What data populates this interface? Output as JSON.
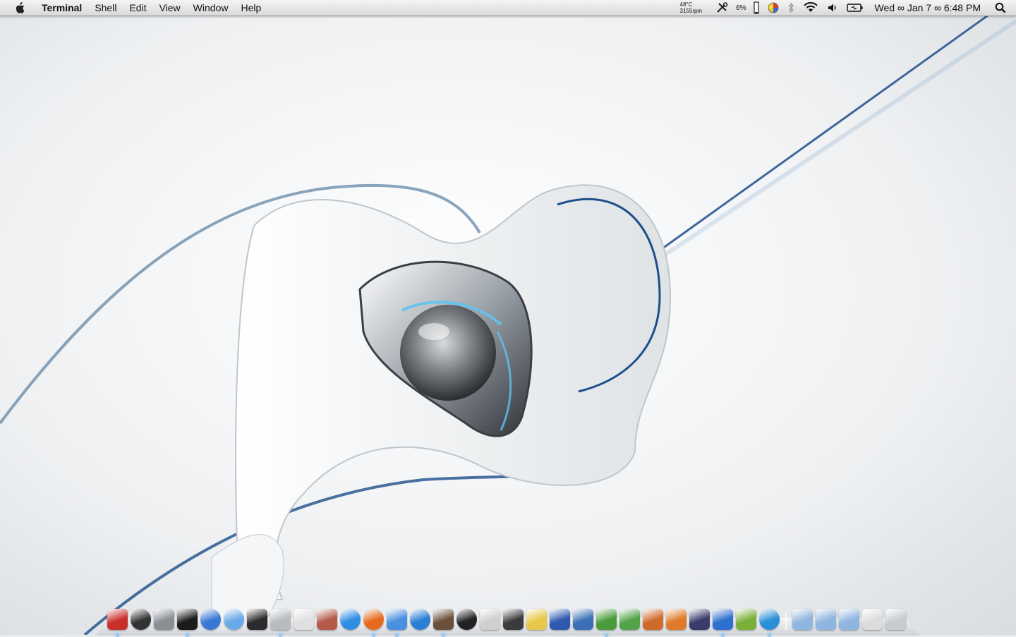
{
  "menubar": {
    "apple_icon": "apple-icon",
    "app_name": "Terminal",
    "menus": [
      "Shell",
      "Edit",
      "View",
      "Window",
      "Help"
    ],
    "status": {
      "temp": "48°C",
      "fan": "3155rpm",
      "cpu": "6%",
      "clock": "Wed ∞ Jan 7 ∞ 6:48 PM"
    }
  },
  "dock": {
    "icons": [
      {
        "name": "finder-icon",
        "color": "#c9302c"
      },
      {
        "name": "dashboard-icon",
        "color": "#333333"
      },
      {
        "name": "system-preferences-icon",
        "color": "#8a8f94"
      },
      {
        "name": "terminal-icon",
        "color": "#1b1b1b"
      },
      {
        "name": "sync-icon",
        "color": "#3a78d6"
      },
      {
        "name": "wifi-app-icon",
        "color": "#6aa9e8"
      },
      {
        "name": "activity-monitor-icon",
        "color": "#2b2b2b"
      },
      {
        "name": "disk-utility-icon",
        "color": "#b8bcc0"
      },
      {
        "name": "printer-icon",
        "color": "#e0e0e0"
      },
      {
        "name": "photo-booth-icon",
        "color": "#b35a4a"
      },
      {
        "name": "safari-icon",
        "color": "#2f8de4"
      },
      {
        "name": "firefox-icon",
        "color": "#e66a1e"
      },
      {
        "name": "itunes-icon",
        "color": "#4b8fe0"
      },
      {
        "name": "quicktime-icon",
        "color": "#2a7fd4"
      },
      {
        "name": "iphoto-icon",
        "color": "#6a4f3a"
      },
      {
        "name": "camera-icon",
        "color": "#222222"
      },
      {
        "name": "automator-icon",
        "color": "#cfcfcf"
      },
      {
        "name": "address-book-icon",
        "color": "#3b3b3b"
      },
      {
        "name": "notes-icon",
        "color": "#e8c84a"
      },
      {
        "name": "vmware-icon",
        "color": "#2f58b0"
      },
      {
        "name": "spaces-icon",
        "color": "#3b6fb5"
      },
      {
        "name": "charts-icon",
        "color": "#4a9b3a"
      },
      {
        "name": "cactus-icon",
        "color": "#53a34a"
      },
      {
        "name": "keynote-icon",
        "color": "#d06a2a"
      },
      {
        "name": "pages-icon",
        "color": "#e07a2a"
      },
      {
        "name": "pen-tool-icon",
        "color": "#3b3b6b"
      },
      {
        "name": "word-icon",
        "color": "#2f6fd0"
      },
      {
        "name": "adium-icon",
        "color": "#7ab03a"
      },
      {
        "name": "network-icon",
        "color": "#2a8fd8"
      },
      {
        "name": "separator",
        "color": ""
      },
      {
        "name": "applications-folder-icon",
        "color": "#8fb6e0"
      },
      {
        "name": "documents-folder-icon",
        "color": "#8fb6e0"
      },
      {
        "name": "downloads-folder-icon",
        "color": "#8fb6e0"
      },
      {
        "name": "stack-folder-icon",
        "color": "#dcdcdc"
      },
      {
        "name": "trash-icon",
        "color": "#c8ccd0"
      }
    ],
    "running": [
      0,
      3,
      7,
      11,
      12,
      14,
      21,
      26,
      28
    ]
  }
}
